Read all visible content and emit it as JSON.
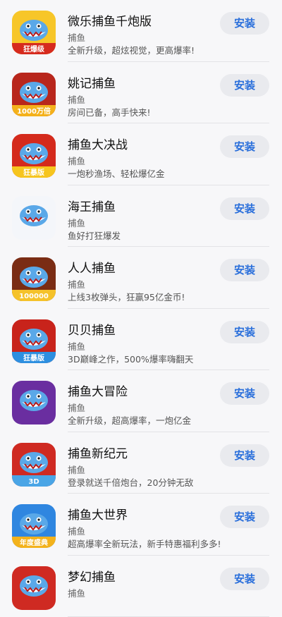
{
  "apps": [
    {
      "title": "微乐捕鱼千炮版",
      "category": "捕鱼",
      "desc": "全新升级，超炫视觉，更高爆率!",
      "install": "安装",
      "icon_text": "狂爆级",
      "icon_bg": "#f7c629",
      "icon_accent": "#d62b1e"
    },
    {
      "title": "姚记捕鱼",
      "category": "捕鱼",
      "desc": "房间已备，高手快来!",
      "install": "安装",
      "icon_text": "1000万倍",
      "icon_bg": "#b8261c",
      "icon_accent": "#f4b11b"
    },
    {
      "title": "捕鱼大决战",
      "category": "捕鱼",
      "desc": "一炮秒渔场、轻松爆亿金",
      "install": "安装",
      "icon_text": "狂暴版",
      "icon_bg": "#d42a1c",
      "icon_accent": "#f6c51e"
    },
    {
      "title": "海王捕鱼",
      "category": "捕鱼",
      "desc": "鱼好打狂爆发",
      "install": "安装",
      "icon_text": "",
      "icon_bg": "#f4f6fa",
      "icon_accent": "#5aa8e8"
    },
    {
      "title": "人人捕鱼",
      "category": "捕鱼",
      "desc": "上线3枚弹头，狂赢95亿金币!",
      "install": "安装",
      "icon_text": "100000",
      "icon_bg": "#7a2c14",
      "icon_accent": "#f5c22a"
    },
    {
      "title": "贝贝捕鱼",
      "category": "捕鱼",
      "desc": "3D巅峰之作，500%爆率嗨翻天",
      "install": "安装",
      "icon_text": "狂暴版",
      "icon_bg": "#c8231b",
      "icon_accent": "#2d8fe0"
    },
    {
      "title": "捕鱼大冒险",
      "category": "捕鱼",
      "desc": "全新升级，超高爆率，一炮亿金",
      "install": "安装",
      "icon_text": "",
      "icon_bg": "#6a2ea0",
      "icon_accent": "#f2b31a"
    },
    {
      "title": "捕鱼新纪元",
      "category": "捕鱼",
      "desc": "登录就送千倍炮台，20分钟无敌",
      "install": "安装",
      "icon_text": "3D",
      "icon_bg": "#cf2a22",
      "icon_accent": "#4aa5e6"
    },
    {
      "title": "捕鱼大世界",
      "category": "捕鱼",
      "desc": "超高爆率全新玩法，新手特惠福利多多!",
      "install": "安装",
      "icon_text": "年度盛典",
      "icon_bg": "#2f86e0",
      "icon_accent": "#f3b21c"
    },
    {
      "title": "梦幻捕鱼",
      "category": "捕鱼",
      "desc": "",
      "install": "安装",
      "icon_text": "",
      "icon_bg": "#cf2a22",
      "icon_accent": "#4aa5e6"
    }
  ]
}
